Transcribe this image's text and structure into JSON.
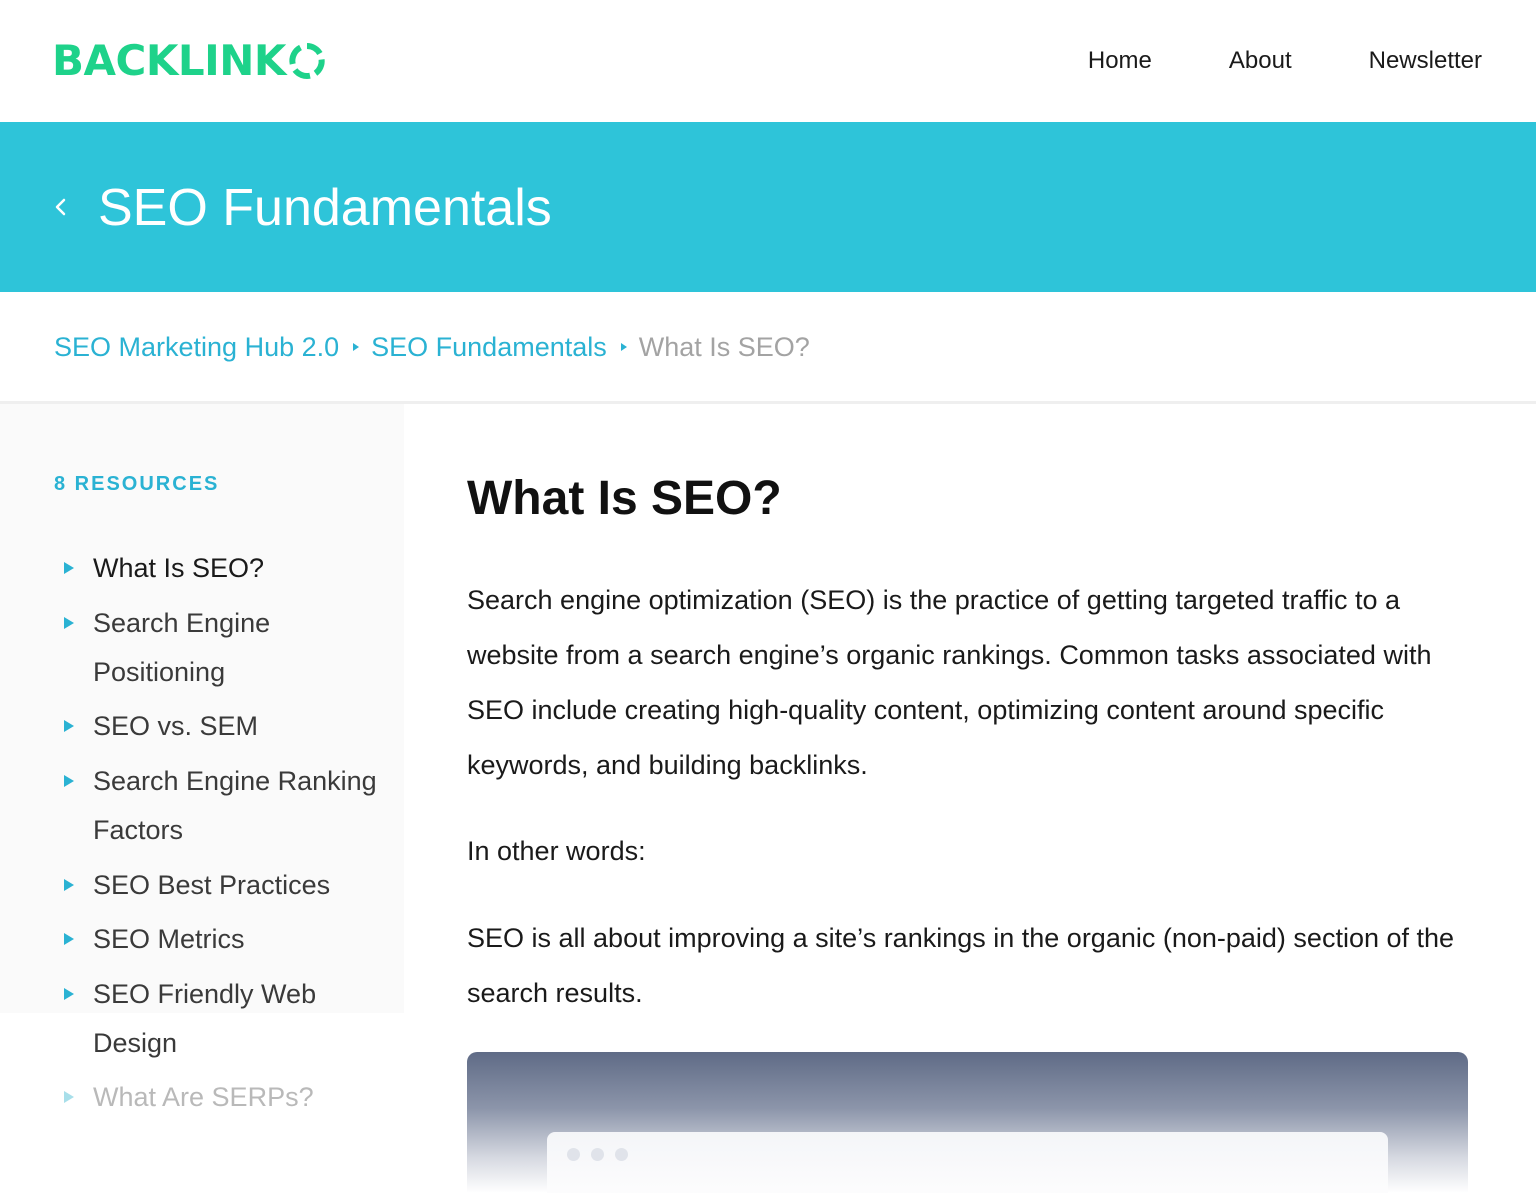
{
  "header": {
    "logo_text": "BACKLINK",
    "logo_icon": "ring-o-icon",
    "nav": [
      "Home",
      "About",
      "Newsletter"
    ]
  },
  "banner": {
    "title": "SEO Fundamentals",
    "back_icon": "chevron-left-icon"
  },
  "breadcrumb": {
    "items": [
      "SEO Marketing Hub 2.0",
      "SEO Fundamentals"
    ],
    "current": "What Is SEO?"
  },
  "sidebar": {
    "heading": "8 RESOURCES",
    "items": [
      {
        "label": "What Is SEO?"
      },
      {
        "label": "Search Engine Positioning"
      },
      {
        "label": "SEO vs. SEM"
      },
      {
        "label": "Search Engine Ranking Factors"
      },
      {
        "label": "SEO Best Practices"
      },
      {
        "label": "SEO Metrics"
      },
      {
        "label": "SEO Friendly Web Design"
      },
      {
        "label": "What Are SERPs?"
      }
    ]
  },
  "article": {
    "title": "What Is SEO?",
    "paragraphs": [
      "Search engine optimization (SEO) is the practice of getting targeted traffic to a website from a search engine’s organic rankings. Common tasks associated with SEO include creating high-quality content, optimizing content around specific keywords, and building backlinks.",
      "In other words:",
      "SEO is all about improving a site’s rankings in the organic (non-paid) section of the search results."
    ]
  },
  "colors": {
    "brand_green": "#1ed28a",
    "banner_teal": "#2ec4d9",
    "link_blue": "#2ab2d3"
  }
}
